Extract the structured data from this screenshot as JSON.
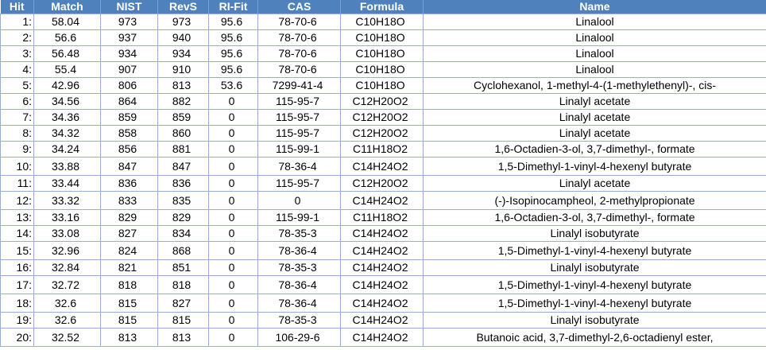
{
  "table": {
    "columns": [
      "Hit",
      "Match",
      "NIST",
      "RevS",
      "RI-Fit",
      "CAS",
      "Formula",
      "Name"
    ],
    "rows": [
      {
        "hit": "1:",
        "match": "58.04",
        "nist": "973",
        "revs": "973",
        "rifit": "95.6",
        "cas": "78-70-6",
        "formula": "C10H18O",
        "name": "Linalool",
        "tall": false
      },
      {
        "hit": "2:",
        "match": "56.6",
        "nist": "937",
        "revs": "940",
        "rifit": "95.6",
        "cas": "78-70-6",
        "formula": "C10H18O",
        "name": "Linalool",
        "tall": false
      },
      {
        "hit": "3:",
        "match": "56.48",
        "nist": "934",
        "revs": "934",
        "rifit": "95.6",
        "cas": "78-70-6",
        "formula": "C10H18O",
        "name": "Linalool",
        "tall": false
      },
      {
        "hit": "4:",
        "match": "55.4",
        "nist": "907",
        "revs": "910",
        "rifit": "95.6",
        "cas": "78-70-6",
        "formula": "C10H18O",
        "name": "Linalool",
        "tall": false
      },
      {
        "hit": "5:",
        "match": "42.96",
        "nist": "806",
        "revs": "813",
        "rifit": "53.6",
        "cas": "7299-41-4",
        "formula": "C10H18O",
        "name": "Cyclohexanol, 1-methyl-4-(1-methylethenyl)-, cis-",
        "tall": false
      },
      {
        "hit": "6:",
        "match": "34.56",
        "nist": "864",
        "revs": "882",
        "rifit": "0",
        "cas": "115-95-7",
        "formula": "C12H20O2",
        "name": "Linalyl acetate",
        "tall": false
      },
      {
        "hit": "7:",
        "match": "34.36",
        "nist": "859",
        "revs": "859",
        "rifit": "0",
        "cas": "115-95-7",
        "formula": "C12H20O2",
        "name": "Linalyl acetate",
        "tall": false
      },
      {
        "hit": "8:",
        "match": "34.32",
        "nist": "858",
        "revs": "860",
        "rifit": "0",
        "cas": "115-95-7",
        "formula": "C12H20O2",
        "name": "Linalyl acetate",
        "tall": false
      },
      {
        "hit": "9:",
        "match": "34.24",
        "nist": "856",
        "revs": "881",
        "rifit": "0",
        "cas": "115-99-1",
        "formula": "C11H18O2",
        "name": "1,6-Octadien-3-ol, 3,7-dimethyl-, formate",
        "tall": false
      },
      {
        "hit": "10:",
        "match": "33.88",
        "nist": "847",
        "revs": "847",
        "rifit": "0",
        "cas": "78-36-4",
        "formula": "C14H24O2",
        "name": "1,5-Dimethyl-1-vinyl-4-hexenyl butyrate",
        "tall": true
      },
      {
        "hit": "11:",
        "match": "33.44",
        "nist": "836",
        "revs": "836",
        "rifit": "0",
        "cas": "115-95-7",
        "formula": "C12H20O2",
        "name": "Linalyl acetate",
        "tall": false
      },
      {
        "hit": "12:",
        "match": "33.32",
        "nist": "833",
        "revs": "835",
        "rifit": "0",
        "cas": "0",
        "formula": "C14H24O2",
        "name": "(-)-Isopinocampheol, 2-methylpropionate",
        "tall": true
      },
      {
        "hit": "13:",
        "match": "33.16",
        "nist": "829",
        "revs": "829",
        "rifit": "0",
        "cas": "115-99-1",
        "formula": "C11H18O2",
        "name": "1,6-Octadien-3-ol, 3,7-dimethyl-, formate",
        "tall": false
      },
      {
        "hit": "14:",
        "match": "33.08",
        "nist": "827",
        "revs": "834",
        "rifit": "0",
        "cas": "78-35-3",
        "formula": "C14H24O2",
        "name": "Linalyl isobutyrate",
        "tall": false
      },
      {
        "hit": "15:",
        "match": "32.96",
        "nist": "824",
        "revs": "868",
        "rifit": "0",
        "cas": "78-36-4",
        "formula": "C14H24O2",
        "name": "1,5-Dimethyl-1-vinyl-4-hexenyl butyrate",
        "tall": true
      },
      {
        "hit": "16:",
        "match": "32.84",
        "nist": "821",
        "revs": "851",
        "rifit": "0",
        "cas": "78-35-3",
        "formula": "C14H24O2",
        "name": "Linalyl isobutyrate",
        "tall": false
      },
      {
        "hit": "17:",
        "match": "32.72",
        "nist": "818",
        "revs": "818",
        "rifit": "0",
        "cas": "78-36-4",
        "formula": "C14H24O2",
        "name": "1,5-Dimethyl-1-vinyl-4-hexenyl butyrate",
        "tall": true
      },
      {
        "hit": "18:",
        "match": "32.6",
        "nist": "815",
        "revs": "827",
        "rifit": "0",
        "cas": "78-36-4",
        "formula": "C14H24O2",
        "name": "1,5-Dimethyl-1-vinyl-4-hexenyl butyrate",
        "tall": true
      },
      {
        "hit": "19:",
        "match": "32.6",
        "nist": "815",
        "revs": "815",
        "rifit": "0",
        "cas": "78-35-3",
        "formula": "C14H24O2",
        "name": "Linalyl isobutyrate",
        "tall": false
      },
      {
        "hit": "20:",
        "match": "32.52",
        "nist": "813",
        "revs": "813",
        "rifit": "0",
        "cas": "106-29-6",
        "formula": "C14H24O2",
        "name": "Butanoic acid, 3,7-dimethyl-2,6-octadienyl ester,",
        "tall": true
      }
    ]
  },
  "colors": {
    "header_bg": "#4f81bd",
    "header_text": "#ffffff",
    "grid_line": "#9aaed6"
  }
}
